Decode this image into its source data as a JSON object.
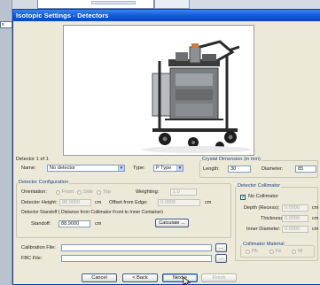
{
  "background_window": {
    "side_label": "s"
  },
  "dialog": {
    "title": "Isotopic Settings - Detectors"
  },
  "detector": {
    "count_label": "Detector 1 of 1",
    "name_label": "Name:",
    "name_value": "No detector",
    "type_label": "Type:",
    "type_value": "P Type"
  },
  "crystal": {
    "title": "Crystal Dimension (in mm)",
    "length_label": "Length:",
    "length_value": "30",
    "diameter_label": "Diameter:",
    "diameter_value": "85"
  },
  "configuration": {
    "title": "Detector Configuration",
    "orientation_label": "Orientation:",
    "orientation_options": [
      "Front",
      "Side",
      "Top"
    ],
    "weighting_label": "Weighting:",
    "weighting_value": "1.0",
    "height_label": "Detector Height:",
    "height_value": "88.9000",
    "height_unit": "cm",
    "offset_label": "Offset from Edge:",
    "offset_value": "0.0000",
    "offset_unit": "cm",
    "standoff_title": "Detector Standoff ( Distance from Collimator Front to Inner Container)",
    "standoff_label": "Standoff:",
    "standoff_value": "88.9000",
    "standoff_unit": "cm",
    "calculate_label": "Calculate ..."
  },
  "collimator": {
    "title": "Detector Collimator",
    "no_collimator_label": "No Collimator",
    "depth_label": "Depth (Recess):",
    "depth_value": "0.0000",
    "thickness_label": "Thickness:",
    "thickness_value": "0.0000",
    "inner_label": "Inner Diameter:",
    "inner_value": "0.0000",
    "unit": "cm",
    "material_title": "Collimator Material",
    "materials": [
      "Pb",
      "Fe",
      "W"
    ]
  },
  "files": {
    "calibration_label": "Calibration File:",
    "fbc_label": "FBC File:",
    "browse_label": "..."
  },
  "buttons": {
    "cancel": "Cancel",
    "back": "< Back",
    "next": "Next >",
    "finish": "Finish"
  }
}
